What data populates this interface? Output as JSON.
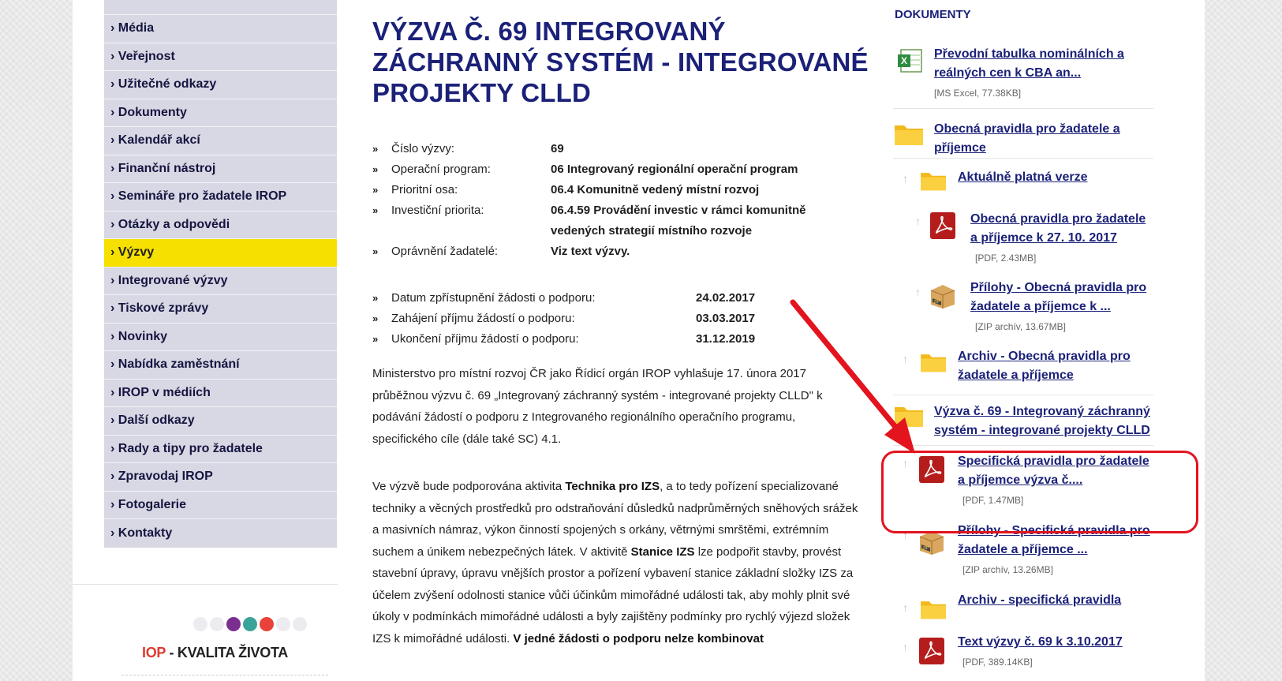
{
  "sidebar": {
    "items": [
      {
        "label": "› Média"
      },
      {
        "label": "› Veřejnost"
      },
      {
        "label": "› Užitečné odkazy"
      },
      {
        "label": "› Dokumenty"
      },
      {
        "label": "› Kalendář akcí"
      },
      {
        "label": "› Finanční nástroj"
      },
      {
        "label": "› Semináře pro žadatele IROP"
      },
      {
        "label": "› Otázky a odpovědi"
      },
      {
        "label": "› Výzvy",
        "active": true
      },
      {
        "label": "› Integrované výzvy"
      },
      {
        "label": "› Tiskové zprávy"
      },
      {
        "label": "› Novinky"
      },
      {
        "label": "› Nabídka zaměstnání"
      },
      {
        "label": "› IROP v médiích"
      },
      {
        "label": "› Další odkazy"
      },
      {
        "label": "› Rady a tipy pro žadatele"
      },
      {
        "label": "› Zpravodaj IROP"
      },
      {
        "label": "› Fotogalerie"
      },
      {
        "label": "› Kontakty"
      }
    ],
    "logo": {
      "accent_text": "IOP",
      "rest_text": " - KVALITA ŽIVOTA",
      "dot_colors": [
        "#ebebf0",
        "#ebebf0",
        "#7a2f8f",
        "#3aa39a",
        "#e8423a",
        "#ebebf0",
        "#ebebf0"
      ]
    }
  },
  "main": {
    "title": "VÝZVA Č. 69 INTEGROVANÝ ZÁCHRANNÝ SYSTÉM - INTEGROVANÉ PROJEKTY CLLD",
    "marker": "»",
    "info_rows": [
      {
        "label": "Číslo výzvy:",
        "value": "69"
      },
      {
        "label": "Operační program:",
        "value": "06 Integrovaný regionální operační program"
      },
      {
        "label": "Prioritní osa:",
        "value": "06.4 Komunitně vedený místní rozvoj"
      },
      {
        "label": "Investiční priorita:",
        "value": "06.4.59 Provádění investic v rámci komunitně vedených strategií místního rozvoje"
      },
      {
        "label": "Oprávnění žadatelé:",
        "value": "Viz text výzvy."
      }
    ],
    "date_rows": [
      {
        "label": "Datum zpřístupnění žádosti o podporu:",
        "value": "24.02.2017"
      },
      {
        "label": "Zahájení příjmu žádostí o podporu:",
        "value": "03.03.2017"
      },
      {
        "label": "Ukončení příjmu žádostí o podporu:",
        "value": "31.12.2019"
      }
    ],
    "paragraph1": "Ministerstvo pro místní rozvoj ČR jako Řídicí orgán IROP vyhlašuje 17. února 2017 průběžnou výzvu č. 69 „Integrovaný záchranný systém - integrované projekty CLLD\" k podávání žádostí o podporu z Integrovaného regionálního operačního programu, specifického cíle  (dále také SC) 4.1.",
    "paragraph2": {
      "t1": "Ve výzvě bude podporována aktivita ",
      "b1": "Technika pro IZS",
      "t2": ", a to tedy pořízení specializované techniky a věcných prostředků pro odstraňování důsledků nadprůměrných sněhových srážek a masivních námraz, výkon činností spojených s orkány, větrnými smrštěmi, extrémním suchem a únikem nebezpečných látek. V aktivitě ",
      "b2": "Stanice IZS",
      "t3": " lze podpořit stavby, provést stavební úpravy, úpravu vnějších prostor a pořízení vybavení stanice základní složky IZS za účelem zvýšení odolnosti stanice vůči účinkům mimořádné události tak, aby mohly plnit své úkoly v podmínkách mimořádné události a byly zajištěny podmínky pro rychlý výjezd složek IZS k mimořádné události. ",
      "b3": "V jedné žádosti o podporu nelze kombinovat"
    }
  },
  "documents": {
    "title": "DOKUMENTY",
    "up_glyph": "↑",
    "items": [
      {
        "label": "Převodní tabulka nominálních a reálných cen k CBA an...",
        "meta": "[MS Excel, 77.38KB]",
        "icon": "excel-icon"
      },
      {
        "label": "Obecná pravidla pro žadatele a příjemce",
        "meta": "",
        "icon": "folder-icon"
      },
      {
        "label": "Aktuálně platná verze",
        "meta": "",
        "icon": "folder-icon"
      },
      {
        "label": "Obecná pravidla pro žadatele a příjemce k 27. 10. 2017",
        "meta": "[PDF, 2.43MB]",
        "icon": "pdf-icon"
      },
      {
        "label": "Přílohy - Obecná pravidla pro žadatele a příjemce k ...",
        "meta": "[ZIP archív, 13.67MB]",
        "icon": "zip-icon"
      },
      {
        "label": "Archiv - Obecná pravidla pro žadatele a příjemce",
        "meta": "",
        "icon": "folder-icon"
      },
      {
        "label": "Výzva č. 69 - Integrovaný záchranný systém - integrované projekty CLLD",
        "meta": "",
        "icon": "folder-icon"
      },
      {
        "label": "Specifická pravidla pro žadatele a příjemce  výzva č....",
        "meta": "[PDF, 1.47MB]",
        "icon": "pdf-icon"
      },
      {
        "label": "Přílohy - Specifická pravidla pro žadatele a příjemce ...",
        "meta": "[ZIP archív, 13.26MB]",
        "icon": "zip-icon"
      },
      {
        "label": "Archiv - specifická pravidla",
        "meta": "",
        "icon": "folder-icon"
      },
      {
        "label": "Text výzvy č. 69 k 3.10.2017",
        "meta": "[PDF, 389.14KB]",
        "icon": "pdf-icon"
      }
    ]
  },
  "annotation_color": "#e3141e"
}
